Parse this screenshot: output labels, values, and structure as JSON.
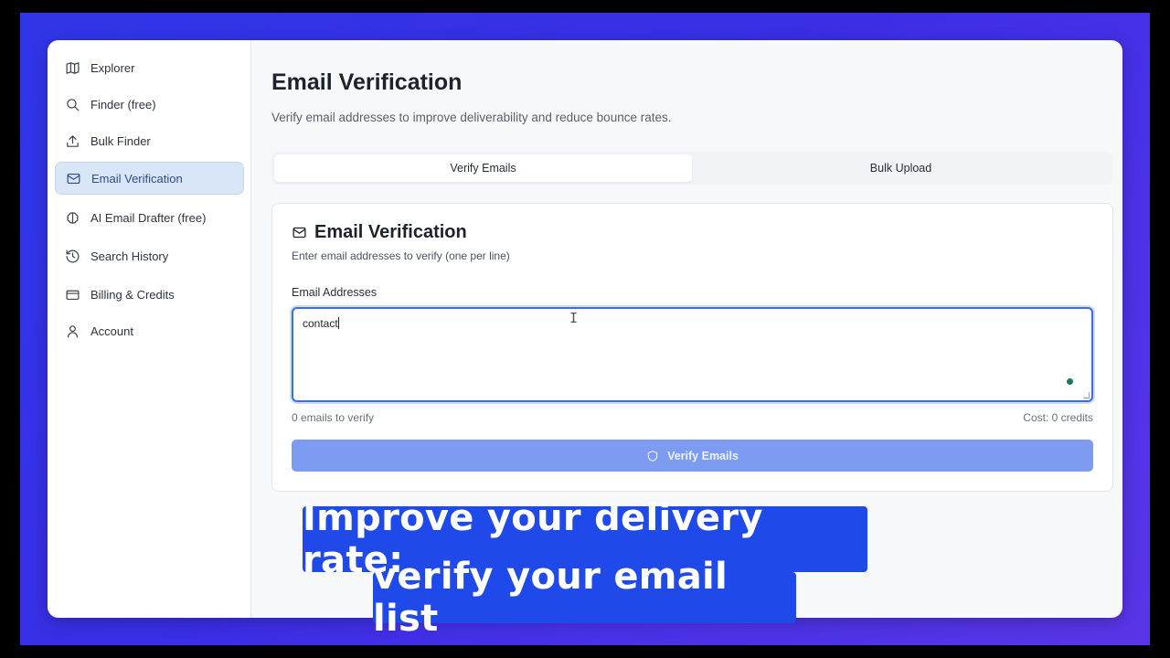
{
  "sidebar": {
    "items": [
      {
        "label": "Explorer",
        "icon": "map-icon"
      },
      {
        "label": "Finder (free)",
        "icon": "search-icon"
      },
      {
        "label": "Bulk Finder",
        "icon": "upload-icon"
      },
      {
        "label": "Email Verification",
        "icon": "mail-icon",
        "active": true
      },
      {
        "label": "AI Email Drafter (free)",
        "icon": "brain-icon"
      },
      {
        "label": "Search History",
        "icon": "history-icon"
      },
      {
        "label": "Billing & Credits",
        "icon": "credit-card-icon"
      },
      {
        "label": "Account",
        "icon": "user-icon"
      }
    ]
  },
  "main": {
    "title": "Email Verification",
    "subtitle": "Verify email addresses to improve deliverability and reduce bounce rates.",
    "tabs": [
      {
        "label": "Verify Emails",
        "active": true
      },
      {
        "label": "Bulk Upload",
        "active": false
      }
    ],
    "card": {
      "title": "Email Verification",
      "subtitle": "Enter email addresses to verify (one per line)",
      "field_label": "Email Addresses",
      "textarea_value": "contact",
      "count_text": "0 emails to verify",
      "cost_text": "Cost: 0 credits",
      "button_label": "Verify Emails"
    }
  },
  "caption": {
    "line1": "Improve your delivery rate:",
    "line2": "verify your email list"
  },
  "colors": {
    "accent": "#3e6fd6",
    "button": "#7d9cf1",
    "active_nav": "#d9e6f7",
    "caption_bg": "#1f49e8",
    "backdrop": "#3a2ee6"
  }
}
